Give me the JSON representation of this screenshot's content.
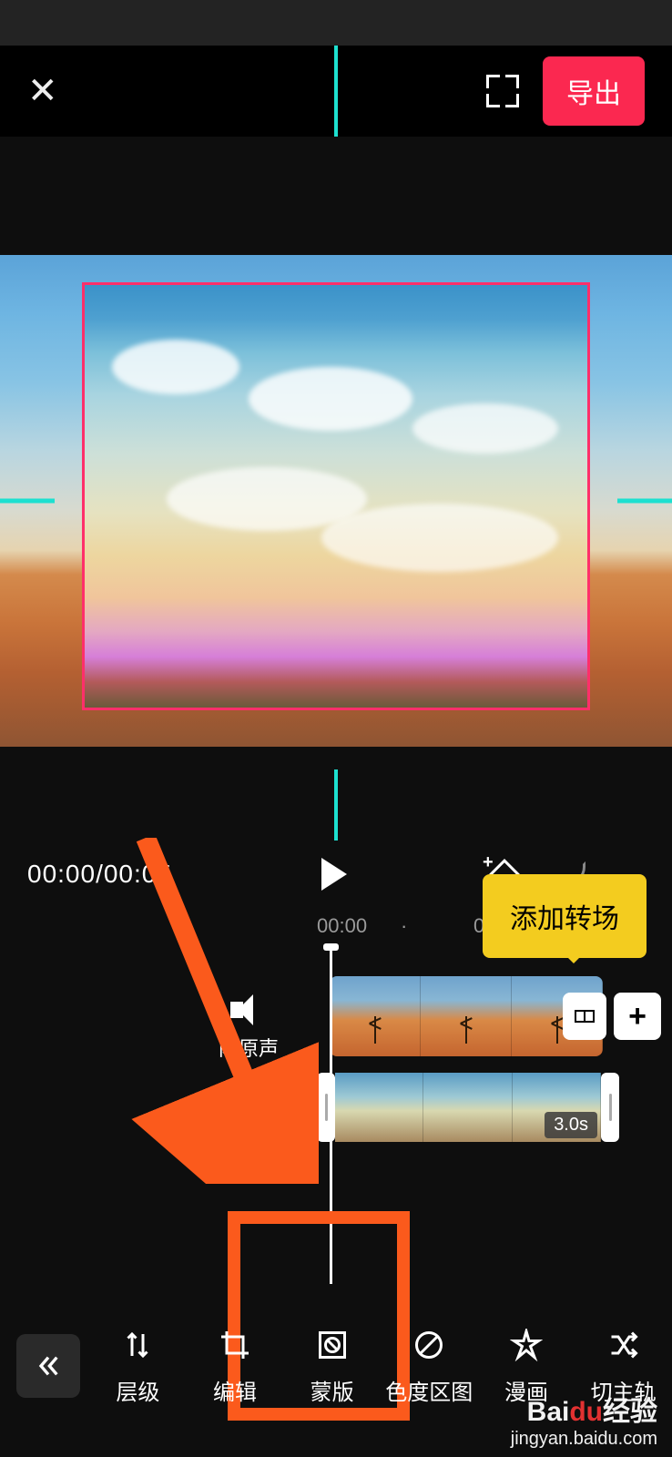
{
  "top_bar": {
    "close_icon": "close",
    "expand_icon": "expand",
    "export_label": "导出"
  },
  "playback": {
    "time": "00:00/00:05",
    "keyframe_icon": "keyframe-add",
    "undo_icon": "undo",
    "redo_icon": "redo"
  },
  "ruler": {
    "marks": [
      "00:00",
      "00:"
    ]
  },
  "tooltip": {
    "text": "添加转场"
  },
  "audio": {
    "label": "闭原声"
  },
  "tracks": {
    "clip2_duration": "3.0s",
    "transition_icon": "transition",
    "add_icon": "+"
  },
  "toolbar": {
    "back_icon": "chevrons-left",
    "items": [
      {
        "id": "level",
        "label": "层级"
      },
      {
        "id": "edit",
        "label": "编辑"
      },
      {
        "id": "mask",
        "label": "蒙版"
      },
      {
        "id": "chroma",
        "label": "色度区图"
      },
      {
        "id": "comic",
        "label": "漫画"
      },
      {
        "id": "main",
        "label": "切主轨"
      }
    ]
  },
  "watermark": {
    "brand_prefix": "Bai",
    "brand_accent": "du",
    "brand_suffix": "经验",
    "url": "jingyan.baidu.com"
  }
}
